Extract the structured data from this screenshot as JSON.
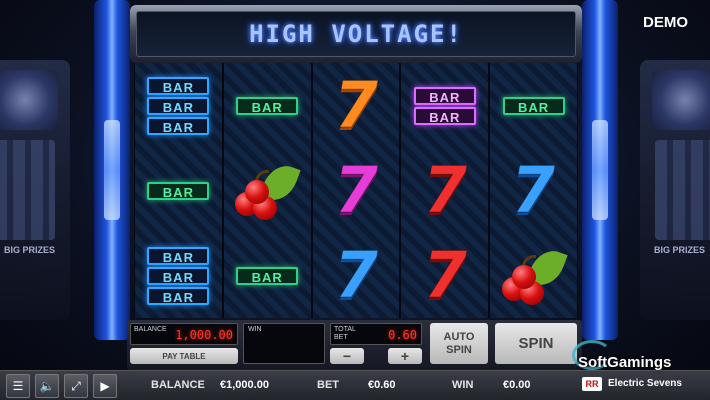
{
  "header": {
    "title": "HIGH VOLTAGE!",
    "demo_badge": "DEMO"
  },
  "background": {
    "prize_text": "BIG PRIZES"
  },
  "reels": [
    [
      "bar-triple-blue",
      "bar-single-green",
      "bar-triple-blue"
    ],
    [
      "bar-single-green",
      "cherry",
      "bar-single-green"
    ],
    [
      "seven-orange",
      "seven-magenta",
      "seven-blue"
    ],
    [
      "bar-double-purple",
      "seven-red",
      "seven-red"
    ],
    [
      "bar-single-green",
      "seven-blue",
      "cherry"
    ]
  ],
  "symbol_text": {
    "bar": "BAR",
    "seven": "7"
  },
  "panel": {
    "balance_label": "BALANCE",
    "balance_value": "1,000.00",
    "paytable_label": "PAY TABLE",
    "win_label": "WIN",
    "win_value": "",
    "totalbet_label": "TOTAL BET",
    "totalbet_value": "0.60",
    "minus_label": "−",
    "plus_label": "+",
    "autospin_label": "AUTO SPIN",
    "spin_label": "SPIN"
  },
  "bottombar": {
    "menu_icon": "hamburger-menu-icon",
    "sound_icon": "speaker-icon",
    "fullscreen_icon": "fullscreen-icon",
    "video_icon": "play-video-icon",
    "balance_label": "BALANCE",
    "balance_value": "€1,000.00",
    "bet_label": "BET",
    "bet_value": "€0.60",
    "win_label": "WIN",
    "win_value": "€0.00"
  },
  "branding": {
    "provider": "SoftGamings",
    "game_name": "Electric Sevens",
    "logo_text": "RR"
  },
  "colors": {
    "frame_blue": "#1f55e0",
    "lcd_red": "#ff3a2a",
    "bar_green": "#30d08a",
    "bar_blue": "#2fa8ff",
    "bar_purple": "#d86fff"
  }
}
